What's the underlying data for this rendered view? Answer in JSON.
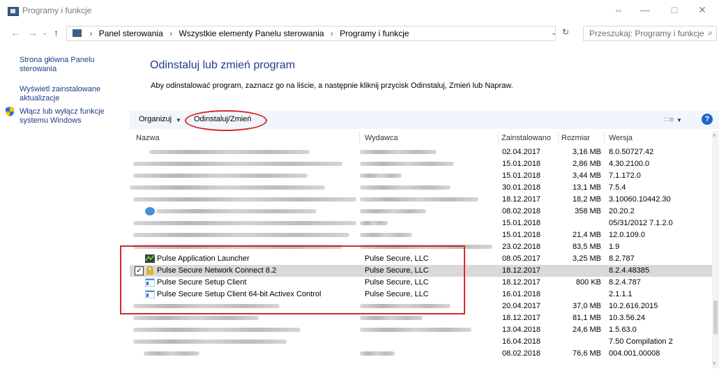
{
  "window": {
    "title": "Programy i funkcje",
    "buttons": {
      "restore_icon": "⇔",
      "minimize": "—",
      "maximize": "□",
      "close": "✕"
    }
  },
  "address": {
    "back": "←",
    "forward": "→",
    "dropdown": "⌄",
    "up": "↑",
    "crumbs": [
      "Panel sterowania",
      "Wszystkie elementy Panelu sterowania",
      "Programy i funkcje"
    ],
    "crumb_sep": "›",
    "refresh": "↻",
    "search_placeholder": "Przeszukaj: Programy i funkcje",
    "search_icon": "⌕"
  },
  "sidebar": {
    "home_link": "Strona główna Panelu sterowania",
    "updates_link": "Wyświetl zainstalowane aktualizacje",
    "features_link": "Włącz lub wyłącz funkcje systemu Windows"
  },
  "main": {
    "title": "Odinstaluj lub zmień program",
    "description": "Aby odinstalować program, zaznacz go na liście, a następnie kliknij przycisk Odinstaluj, Zmień lub Napraw."
  },
  "toolbar": {
    "organize": "Organizuj",
    "organize_arrow": "▼",
    "uninstall": "Odinstaluj/Zmień",
    "view_icon": "∷≡",
    "view_arrow": "▼",
    "help": "?"
  },
  "columns": {
    "name": "Nazwa",
    "publisher": "Wydawca",
    "installed": "Zainstalowano",
    "size": "Rozmiar",
    "version": "Wersja"
  },
  "rows": [
    {
      "name": "",
      "publisher": "",
      "installed": "02.04.2017",
      "size": "3,16 MB",
      "version": "8.0.50727.42"
    },
    {
      "name": "",
      "publisher": "",
      "installed": "15.01.2018",
      "size": "2,86 MB",
      "version": "4.30.2100.0"
    },
    {
      "name": "",
      "publisher": "",
      "installed": "15.01.2018",
      "size": "3,44 MB",
      "version": "7.1.172.0"
    },
    {
      "name": "",
      "publisher": "",
      "installed": "30.01.2018",
      "size": "13,1 MB",
      "version": "7.5.4"
    },
    {
      "name": "",
      "publisher": "",
      "installed": "18.12.2017",
      "size": "18,2 MB",
      "version": "3.10060.10442.30"
    },
    {
      "name": "",
      "publisher": "",
      "installed": "08.02.2018",
      "size": "358 MB",
      "version": "20.20.2"
    },
    {
      "name": "",
      "publisher": "",
      "installed": "15.01.2018",
      "size": "",
      "version": "05/31/2012 7.1.2.0"
    },
    {
      "name": "",
      "publisher": "",
      "installed": "15.01.2018",
      "size": "21,4 MB",
      "version": "12.0.109.0"
    },
    {
      "name": "",
      "publisher": "",
      "installed": "23.02.2018",
      "size": "83,5 MB",
      "version": "1.9"
    },
    {
      "name": "Pulse Application Launcher",
      "publisher": "Pulse Secure, LLC",
      "installed": "08.05.2017",
      "size": "3,25 MB",
      "version": "8.2.787"
    },
    {
      "name": "Pulse Secure Network Connect 8.2",
      "publisher": "Pulse Secure, LLC",
      "installed": "18.12.2017",
      "size": "",
      "version": "8.2.4.48385"
    },
    {
      "name": "Pulse Secure Setup Client",
      "publisher": "Pulse Secure, LLC",
      "installed": "18.12.2017",
      "size": "800 KB",
      "version": "8.2.4.787"
    },
    {
      "name": "Pulse Secure Setup Client 64-bit Activex Control",
      "publisher": "Pulse Secure, LLC",
      "installed": "16.01.2018",
      "size": "",
      "version": "2.1.1.1"
    },
    {
      "name": "",
      "publisher": "",
      "installed": "20.04.2017",
      "size": "37,0 MB",
      "version": "10.2.616.2015"
    },
    {
      "name": "",
      "publisher": "",
      "installed": "18.12.2017",
      "size": "81,1 MB",
      "version": "10.3.56.24"
    },
    {
      "name": "",
      "publisher": "",
      "installed": "13.04.2018",
      "size": "24,6 MB",
      "version": "1.5.63.0"
    },
    {
      "name": "",
      "publisher": "",
      "installed": "16.04.2018",
      "size": "",
      "version": "7.50 Compilation 2"
    },
    {
      "name": "",
      "publisher": "",
      "installed": "08.02.2018",
      "size": "76,6 MB",
      "version": "004.001.00008"
    }
  ],
  "checkbox_mark": "✓",
  "scroll": {
    "up": "˄",
    "down": "˅"
  },
  "colors": {
    "link": "#1c3d85",
    "title": "#1e3c8c",
    "annotation": "#d8262a",
    "selected_row": "#d9d9d9",
    "toolbar": "#f0f6fb"
  }
}
